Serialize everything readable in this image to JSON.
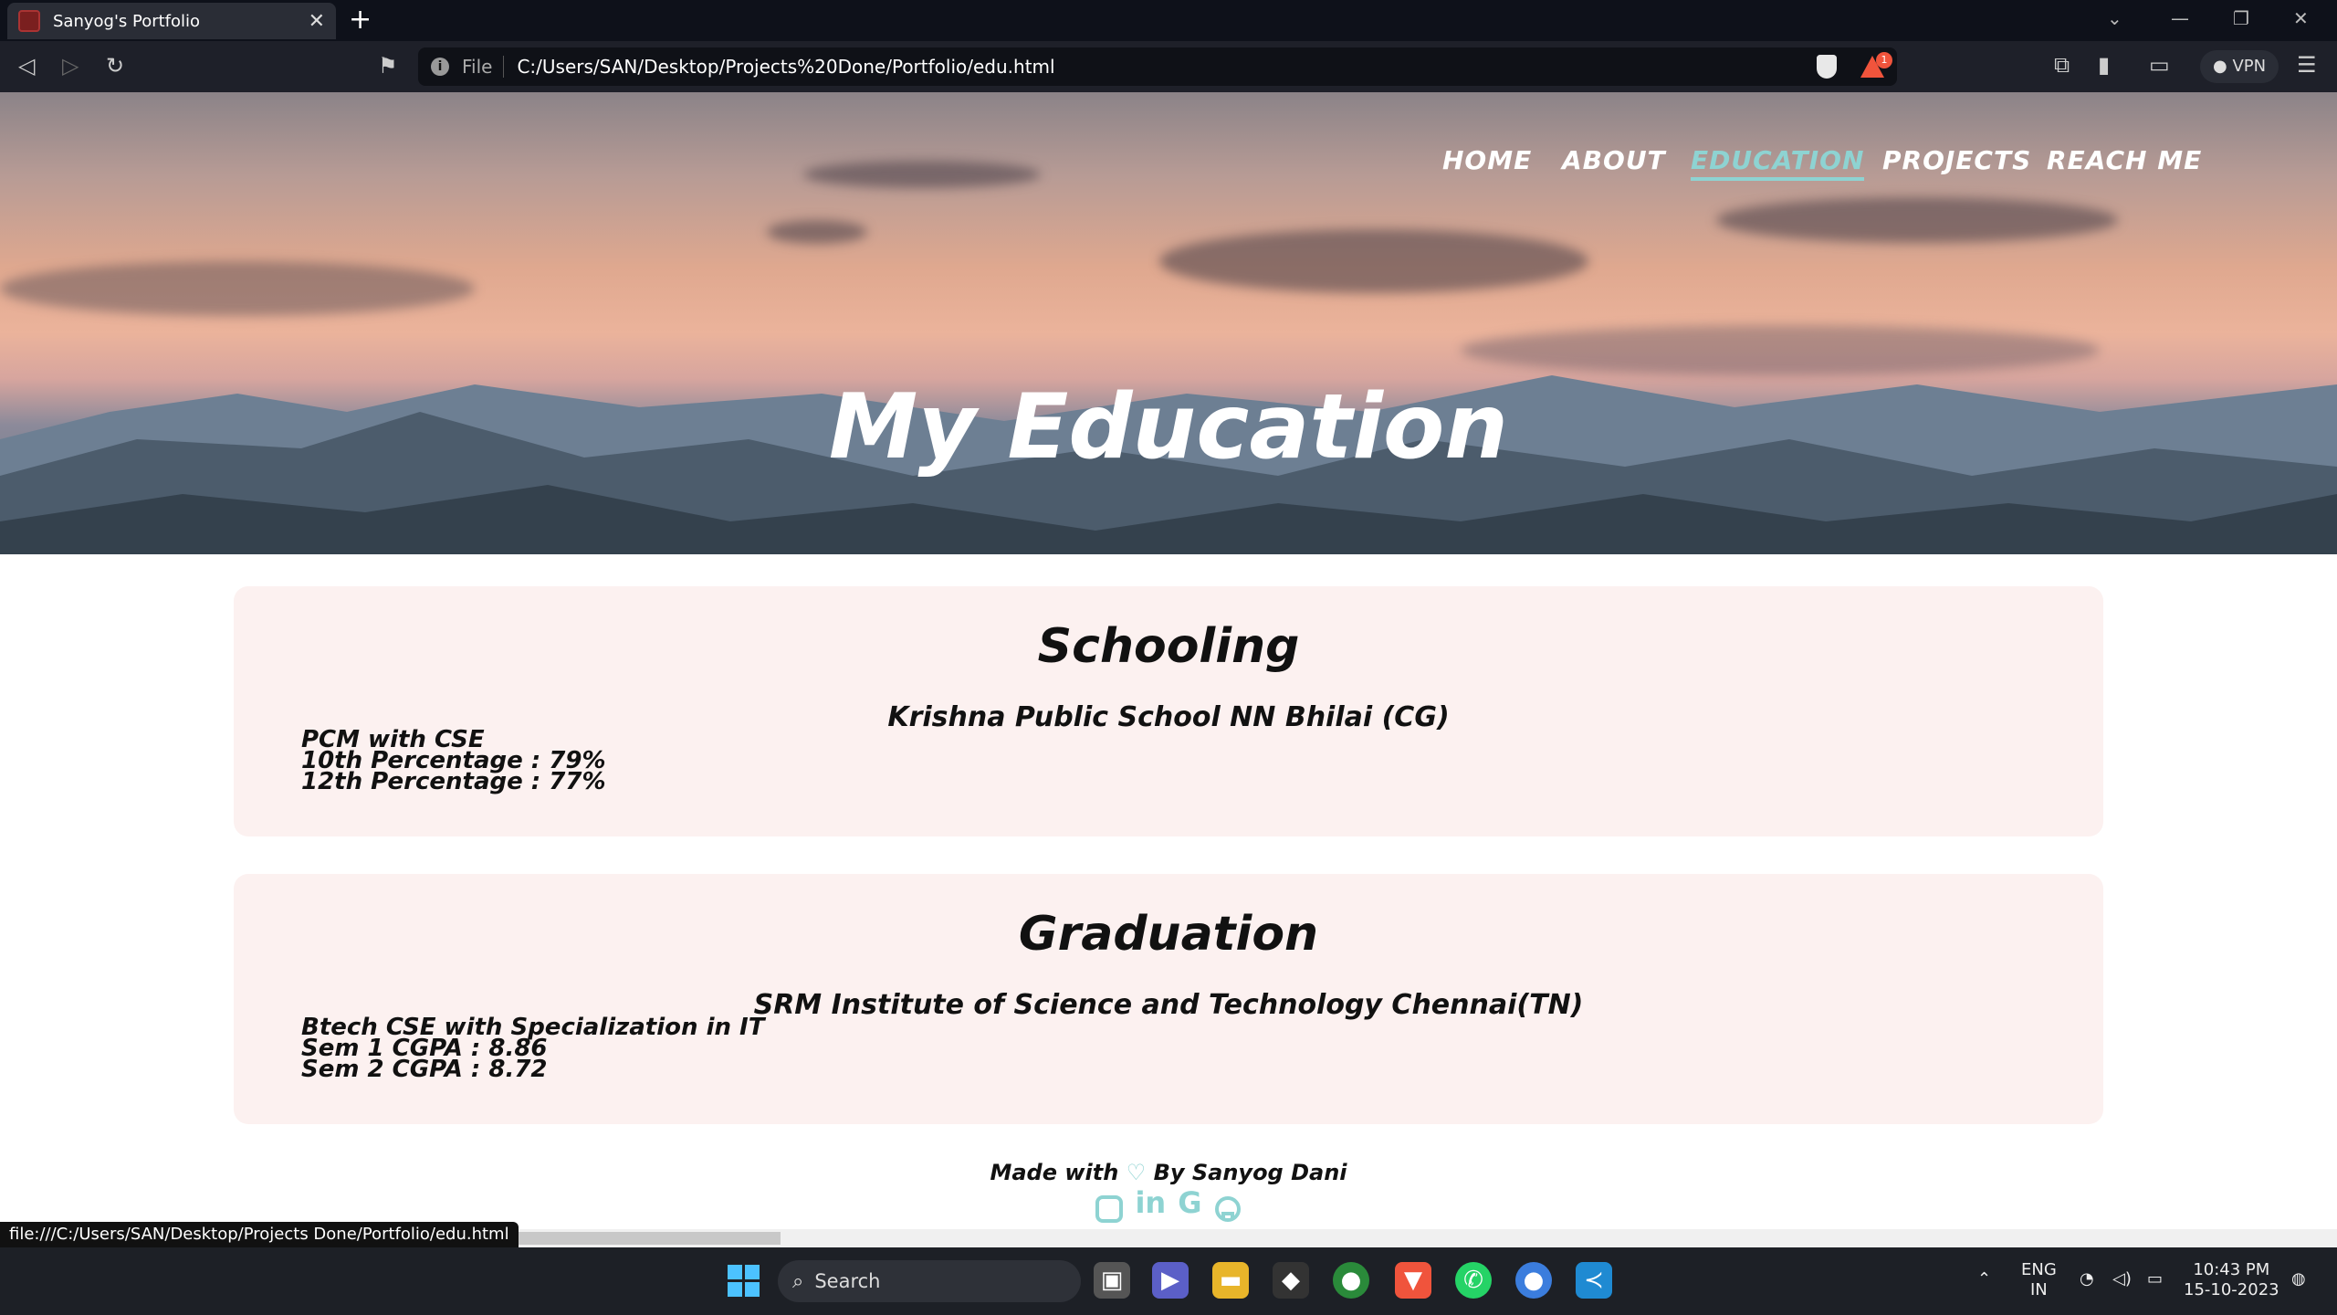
{
  "browser": {
    "tab_title": "Sanyog's Portfolio",
    "tab_close": "✕",
    "new_tab": "+",
    "url_scheme_label": "File",
    "url": "C:/Users/SAN/Desktop/Projects%20Done/Portfolio/edu.html",
    "shield_badge": "1",
    "vpn_label": "VPN",
    "status_url": "file:///C:/Users/SAN/Desktop/Projects Done/Portfolio/edu.html"
  },
  "nav": {
    "items": [
      {
        "label": "HOME"
      },
      {
        "label": "ABOUT"
      },
      {
        "label": "EDUCATION",
        "active": true
      },
      {
        "label": "PROJECTS"
      },
      {
        "label": "REACH ME"
      }
    ],
    "accent": "#8ed3d2"
  },
  "hero": {
    "title": "My Education"
  },
  "education": [
    {
      "heading": "Schooling",
      "institution": "Krishna Public School NN Bhilai (CG)",
      "details": [
        "PCM with CSE",
        "10th Percentage : 79%",
        "12th Percentage : 77%"
      ]
    },
    {
      "heading": "Graduation",
      "institution": "SRM Institute of Science and Technology Chennai(TN)",
      "details": [
        "Btech CSE with Specialization in IT",
        "Sem 1 CGPA : 8.86",
        "Sem 2 CGPA : 8.72"
      ]
    }
  ],
  "footer": {
    "made_with": "Made with",
    "heart": "♡",
    "by": "By Sanyog Dani",
    "socials": [
      "instagram-icon",
      "linkedin-icon",
      "google-icon",
      "github-icon"
    ],
    "linkedin_text": "in",
    "google_text": "G"
  },
  "taskbar": {
    "search_placeholder": "Search",
    "lang_top": "ENG",
    "lang_bottom": "IN",
    "time": "10:43 PM",
    "date": "15-10-2023"
  },
  "colors": {
    "card_bg": "#fcf1f0",
    "accent": "#8ed3d2"
  }
}
